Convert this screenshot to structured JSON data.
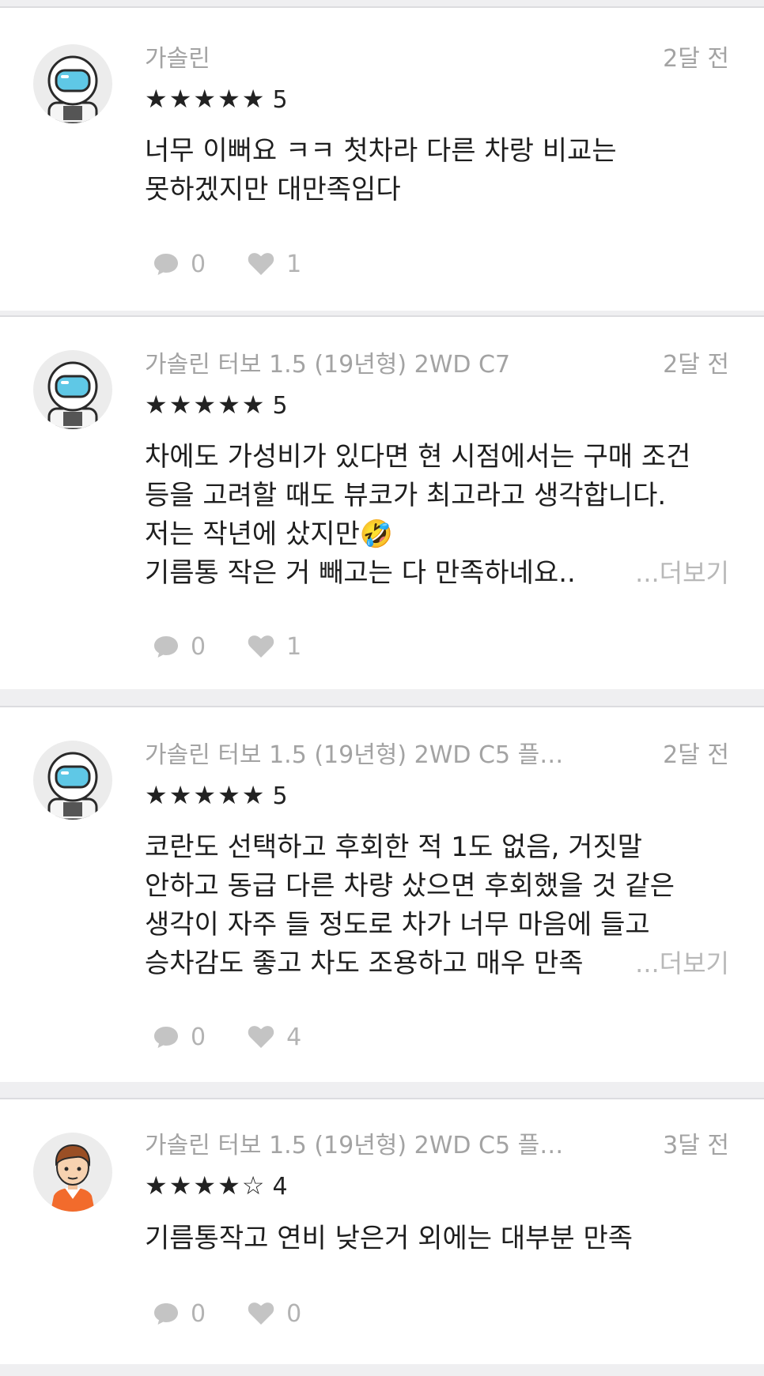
{
  "reviews": [
    {
      "trim": "가솔린",
      "date": "2달 전",
      "stars": "★★★★★",
      "score": "5",
      "body_lines": [
        "너무 이뻐요 ㅋㅋ 첫차라 다른 차랑 비교는",
        "못하겠지만 대만족임다"
      ],
      "more_label": "",
      "comment_count": "0",
      "like_count": "1",
      "avatar_icon": "astronaut-avatar-icon"
    },
    {
      "trim": "가솔린 터보 1.5 (19년형) 2WD C7",
      "date": "2달 전",
      "stars": "★★★★★",
      "score": "5",
      "body_lines": [
        "차에도 가성비가 있다면 현 시점에서는 구매 조건",
        "등을 고려할 때도 뷰코가 최고라고 생각합니다.",
        "저는 작년에 샀지만🤣",
        "기름통 작은 거 빼고는 다 만족하네요.."
      ],
      "more_label": "...더보기",
      "comment_count": "0",
      "like_count": "1",
      "avatar_icon": "astronaut-avatar-icon"
    },
    {
      "trim": "가솔린 터보 1.5 (19년형) 2WD C5 플…",
      "date": "2달 전",
      "stars": "★★★★★",
      "score": "5",
      "body_lines": [
        "코란도 선택하고 후회한 적 1도 없음, 거짓말",
        "안하고 동급 다른 차량 샀으면 후회했을 것 같은",
        "생각이 자주 들 정도로 차가 너무 마음에 들고",
        "승차감도 좋고 차도 조용하고 매우 만족"
      ],
      "more_label": "...더보기",
      "comment_count": "0",
      "like_count": "4",
      "avatar_icon": "astronaut-avatar-icon"
    },
    {
      "trim": "가솔린 터보 1.5 (19년형) 2WD C5 플…",
      "date": "3달 전",
      "stars": "★★★★☆",
      "score": "4",
      "body_lines": [
        "기름통작고 연비 낮은거 외에는 대부분 만족"
      ],
      "more_label": "",
      "comment_count": "0",
      "like_count": "0",
      "avatar_icon": "man-avatar-icon"
    }
  ],
  "colors": {
    "background": "#efeff1",
    "card": "#ffffff",
    "meta_text": "#a3a3a3",
    "body_text": "#1e1e1e",
    "icon_gray": "#c4c4c4",
    "visor_cyan": "#5fc8e6"
  }
}
